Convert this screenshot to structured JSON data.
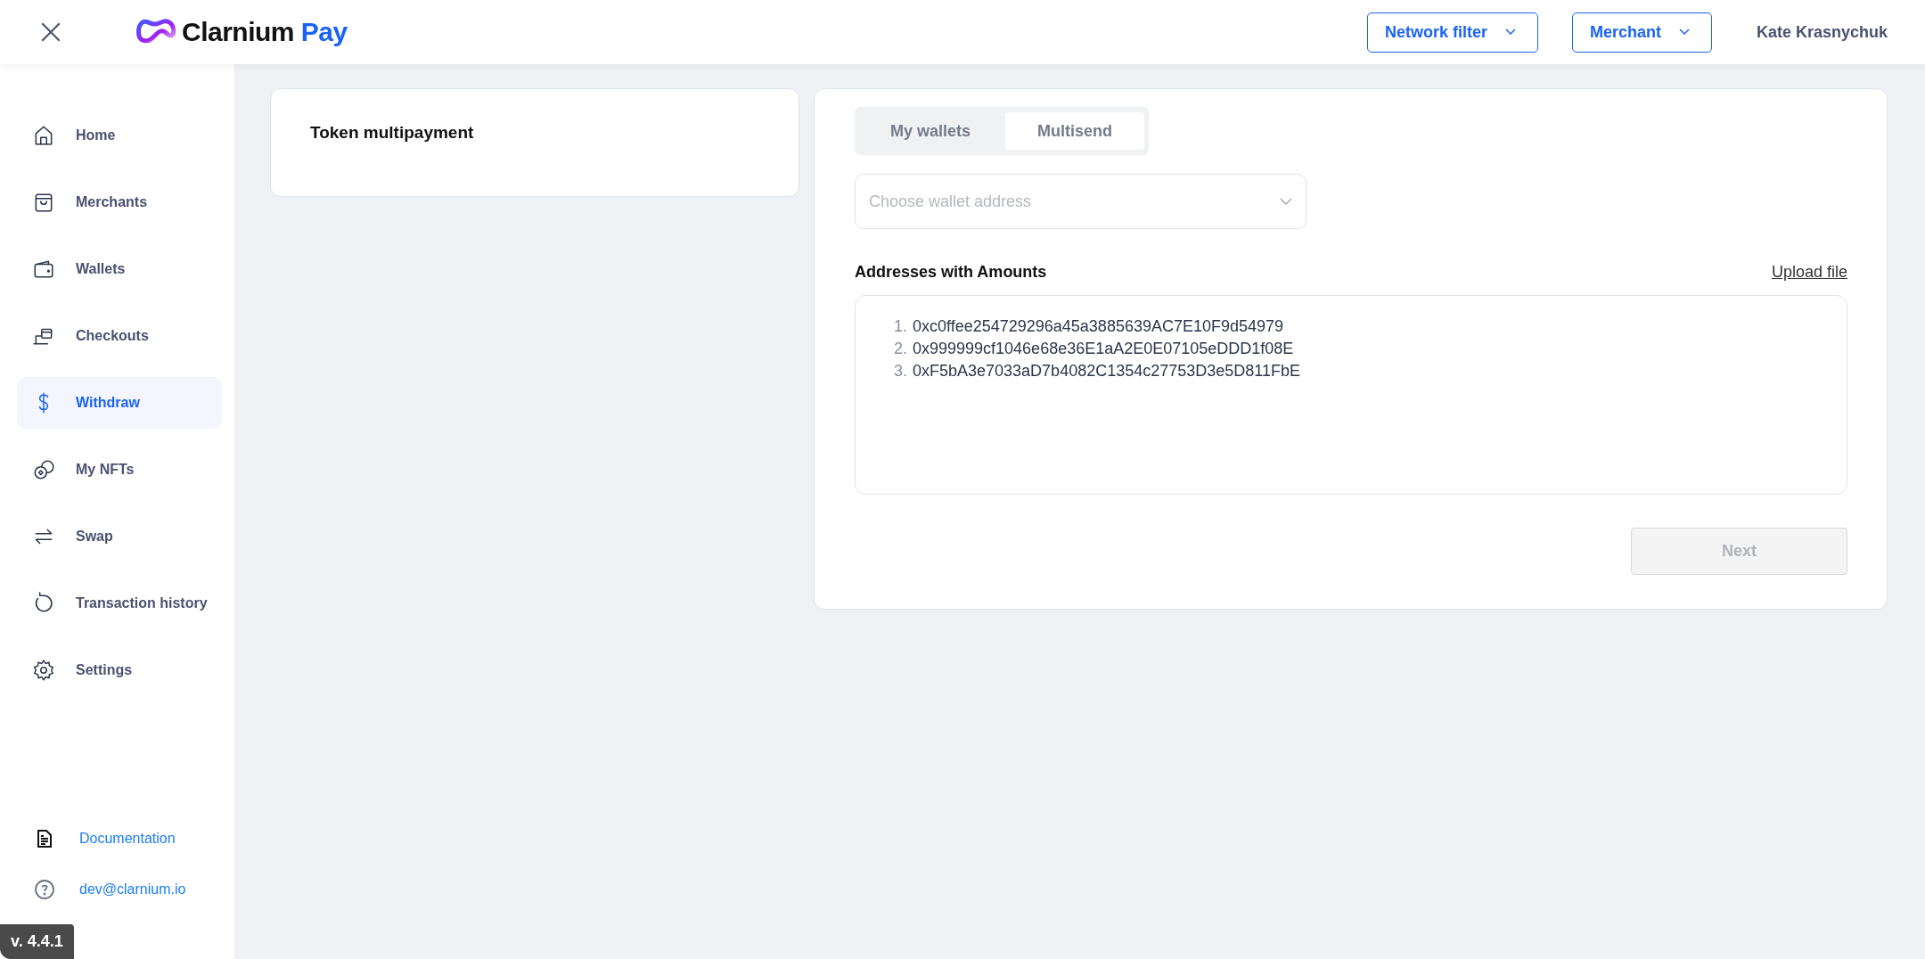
{
  "header": {
    "logo": {
      "brand": "Clarnium",
      "accent": "Pay"
    },
    "network_filter": "Network filter",
    "merchant": "Merchant",
    "user_name": "Kate Krasnychuk"
  },
  "sidebar": {
    "items": [
      {
        "label": "Home",
        "selected": false
      },
      {
        "label": "Merchants",
        "selected": false
      },
      {
        "label": "Wallets",
        "selected": false
      },
      {
        "label": "Checkouts",
        "selected": false
      },
      {
        "label": "Withdraw",
        "selected": true
      },
      {
        "label": "My NFTs",
        "selected": false
      },
      {
        "label": "Swap",
        "selected": false
      },
      {
        "label": "Transaction history",
        "selected": false
      },
      {
        "label": "Settings",
        "selected": false
      }
    ],
    "footer_links": [
      {
        "label": "Documentation"
      },
      {
        "label": "dev@clarnium.io"
      }
    ],
    "version": "v. 4.4.1"
  },
  "left_card": {
    "title": "Token multipayment"
  },
  "right_card": {
    "tabs": [
      {
        "label": "My wallets",
        "selected": false
      },
      {
        "label": "Multisend",
        "selected": true
      }
    ],
    "wallet_select": {
      "placeholder": "Choose wallet address"
    },
    "addresses_label": "Addresses with Amounts",
    "upload_link": "Upload file",
    "addresses": [
      {
        "number": "1.",
        "address": "0xc0ffee254729296a45a3885639AC7E10F9d54979"
      },
      {
        "number": "2.",
        "address": "0x999999cf1046e68e36E1aA2E0E07105eDDD1f08E"
      },
      {
        "number": "3.",
        "address": "0xF5bA3e7033aD7b4082C1354c27753D3e5D811FbE"
      }
    ],
    "next_button": {
      "label": "Next",
      "disabled": true
    }
  }
}
